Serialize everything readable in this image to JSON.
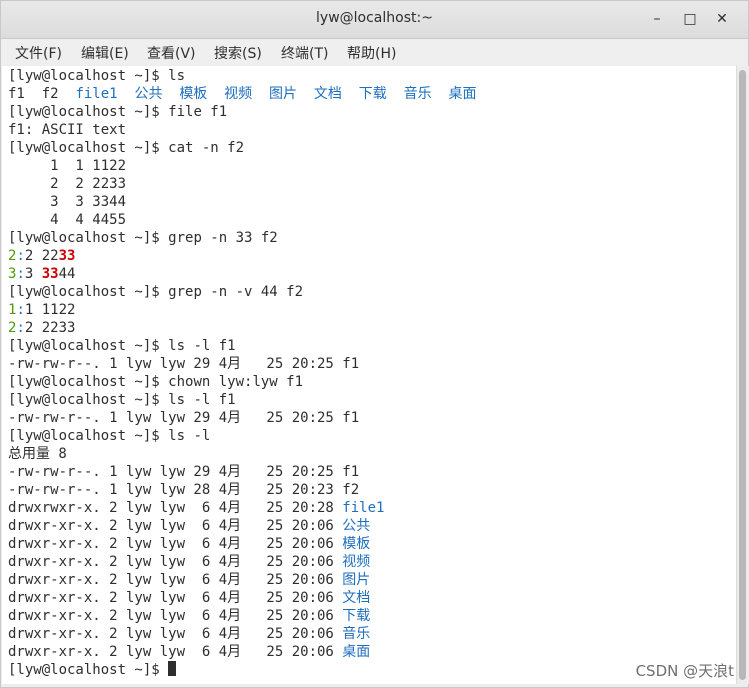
{
  "window": {
    "title": "lyw@localhost:~",
    "minimize": "–",
    "maximize": "□",
    "close": "✕"
  },
  "menu": [
    "文件(F)",
    "编辑(E)",
    "查看(V)",
    "搜索(S)",
    "终端(T)",
    "帮助(H)"
  ],
  "prompt": "[lyw@localhost ~]$ ",
  "terminal": {
    "cmd_ls": "ls",
    "ls_output": [
      "f1",
      "f2",
      "file1",
      "公共",
      "模板",
      "视频",
      "图片",
      "文档",
      "下载",
      "音乐",
      "桌面"
    ],
    "cmd_file": "file f1",
    "file_output": "f1: ASCII text",
    "cmd_cat": "cat -n f2",
    "cat_output": [
      "     1\t1 1122",
      "     2\t2 2233",
      "     3\t3 3344",
      "     4\t4 4455"
    ],
    "cmd_grep_n": "grep -n 33 f2",
    "grep_n_output": [
      {
        "num": "2",
        "sep": ":",
        "pre": "2 22",
        "match": "33",
        "post": ""
      },
      {
        "num": "3",
        "sep": ":",
        "pre": "3 ",
        "match": "33",
        "post": "44"
      }
    ],
    "cmd_grep_v": "grep -n -v 44 f2",
    "grep_v_output": [
      {
        "num": "1",
        "sep": ":",
        "text": "1 1122"
      },
      {
        "num": "2",
        "sep": ":",
        "text": "2 2233"
      }
    ],
    "cmd_ls_l_1": "ls -l f1",
    "ls_l_1_output": "-rw-rw-r--. 1 lyw lyw 29 4月   25 20:25 f1",
    "cmd_chown": "chown lyw:lyw f1",
    "cmd_ls_l_2": "ls -l f1",
    "ls_l_2_output": "-rw-rw-r--. 1 lyw lyw 29 4月   25 20:25 f1",
    "cmd_ls_l_3": "ls -l",
    "total": "总用量 8",
    "ls_l_rows": [
      {
        "meta": "-rw-rw-r--. 1 lyw lyw 29 4月   25 20:25 ",
        "name": "f1",
        "dir": false
      },
      {
        "meta": "-rw-rw-r--. 1 lyw lyw 28 4月   25 20:23 ",
        "name": "f2",
        "dir": false
      },
      {
        "meta": "drwxrwxr-x. 2 lyw lyw  6 4月   25 20:28 ",
        "name": "file1",
        "dir": true
      },
      {
        "meta": "drwxr-xr-x. 2 lyw lyw  6 4月   25 20:06 ",
        "name": "公共",
        "dir": true
      },
      {
        "meta": "drwxr-xr-x. 2 lyw lyw  6 4月   25 20:06 ",
        "name": "模板",
        "dir": true
      },
      {
        "meta": "drwxr-xr-x. 2 lyw lyw  6 4月   25 20:06 ",
        "name": "视频",
        "dir": true
      },
      {
        "meta": "drwxr-xr-x. 2 lyw lyw  6 4月   25 20:06 ",
        "name": "图片",
        "dir": true
      },
      {
        "meta": "drwxr-xr-x. 2 lyw lyw  6 4月   25 20:06 ",
        "name": "文档",
        "dir": true
      },
      {
        "meta": "drwxr-xr-x. 2 lyw lyw  6 4月   25 20:06 ",
        "name": "下载",
        "dir": true
      },
      {
        "meta": "drwxr-xr-x. 2 lyw lyw  6 4月   25 20:06 ",
        "name": "音乐",
        "dir": true
      },
      {
        "meta": "drwxr-xr-x. 2 lyw lyw  6 4月   25 20:06 ",
        "name": "桌面",
        "dir": true
      }
    ]
  },
  "watermark": "CSDN @天浪t",
  "colors": {
    "directory": "#1e6fbf",
    "line_number": "#4e9a06",
    "match": "#cc0000"
  }
}
